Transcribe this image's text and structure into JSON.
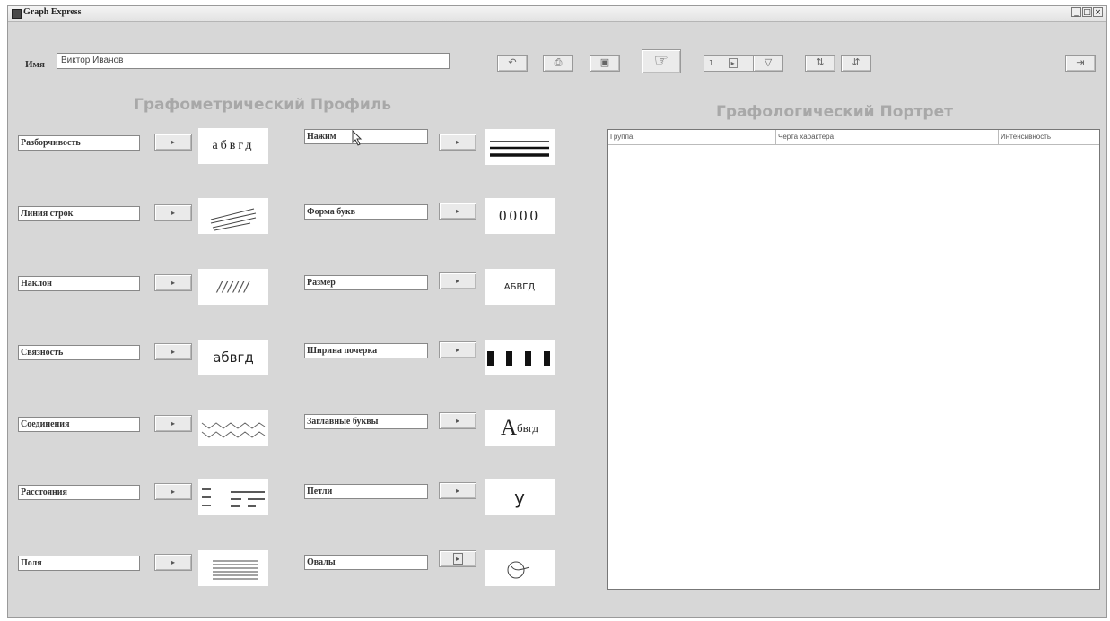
{
  "window": {
    "title": "Graph Express"
  },
  "window_buttons": [
    "_",
    "□",
    "×"
  ],
  "name_field": {
    "label": "Имя",
    "value": "Виктор Иванов"
  },
  "toolbar": {
    "undo_icon": "↶",
    "print_icon": "⎙",
    "save_icon": "▣",
    "hand_icon": "☞",
    "nav_value": "1",
    "nav_spinner": "▸",
    "filter_icon": "▽",
    "sort_asc_icon": "⇅",
    "sort_desc_icon": "⇵",
    "exit_icon": "⇥"
  },
  "profile": {
    "title": "Графометрический Профиль",
    "arrow": "▸",
    "left_params": [
      {
        "label": "Разборчивость",
        "sample": "абвгд"
      },
      {
        "label": "Линия строк",
        "sample_icon": "slanted-lines"
      },
      {
        "label": "Наклон",
        "sample": "//////"
      },
      {
        "label": "Связность",
        "sample": "абвгд"
      },
      {
        "label": "Соединения",
        "sample_icon": "wave-connections"
      },
      {
        "label": "Расстояния",
        "sample_icon": "spacing-dashes"
      },
      {
        "label": "Поля",
        "sample_icon": "margin-lines"
      }
    ],
    "right_params": [
      {
        "label": "Нажим",
        "sample_icon": "pressure-lines"
      },
      {
        "label": "Форма букв",
        "sample": "0000"
      },
      {
        "label": "Размер",
        "sample": "АБВГД"
      },
      {
        "label": "Ширина почерка",
        "sample_icon": "width-bars"
      },
      {
        "label": "Заглавные буквы",
        "sample_cap": "А",
        "sample_rest": "бвгд"
      },
      {
        "label": "Петли",
        "sample": "у"
      },
      {
        "label": "Овалы",
        "sample_icon": "oval-loop"
      }
    ]
  },
  "portrait": {
    "title": "Графологический Портрет",
    "columns": [
      "Группа",
      "Черта характера",
      "Интенсивность"
    ]
  }
}
